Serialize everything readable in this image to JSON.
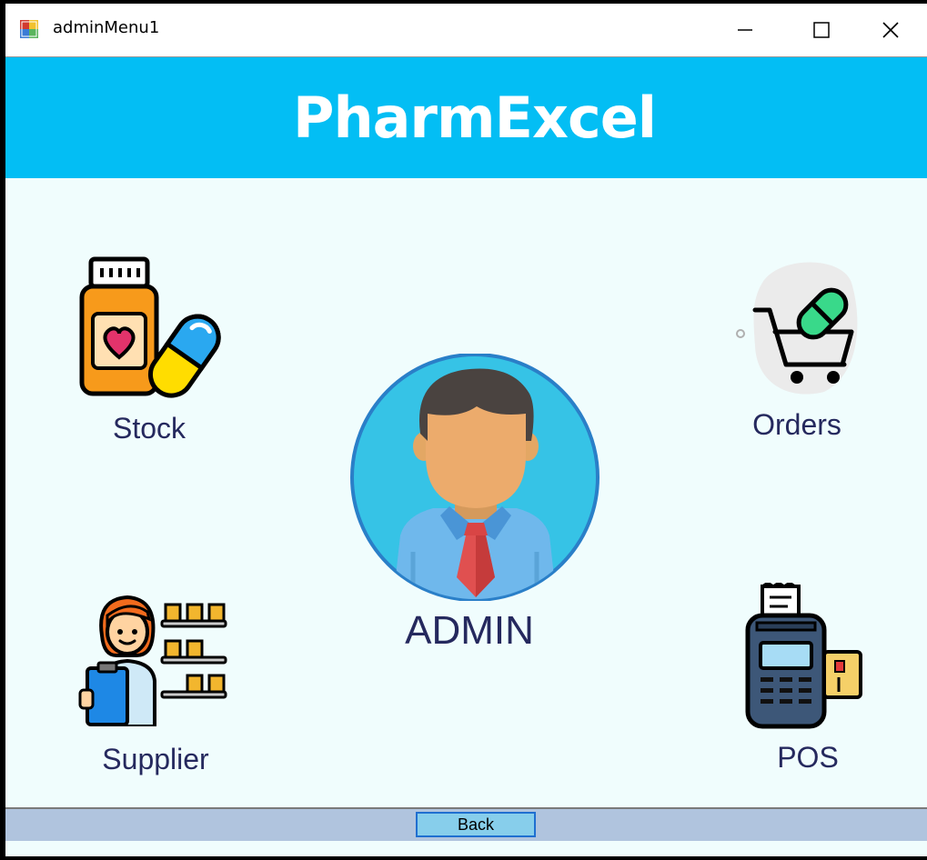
{
  "window": {
    "title": "adminMenu1",
    "controls": {
      "minimize": "—",
      "maximize": "☐",
      "close": "✕"
    }
  },
  "header": {
    "app_name": "PharmExcel",
    "background_color": "#03bef4"
  },
  "menu": {
    "stock": {
      "label": "Stock",
      "icon": "medicine-bottle-pill-icon"
    },
    "orders": {
      "label": "Orders",
      "icon": "cart-pill-icon"
    },
    "supplier": {
      "label": "Supplier",
      "icon": "warehouse-worker-icon"
    },
    "pos": {
      "label": "POS",
      "icon": "card-terminal-icon"
    }
  },
  "admin": {
    "label": "ADMIN",
    "icon": "admin-avatar-icon"
  },
  "footer": {
    "back_label": "Back"
  },
  "colors": {
    "content_bg": "#f0fdfd",
    "label_text": "#25295e",
    "statusbar_bg": "#b0c4de",
    "back_button_bg": "#87ceeb"
  }
}
